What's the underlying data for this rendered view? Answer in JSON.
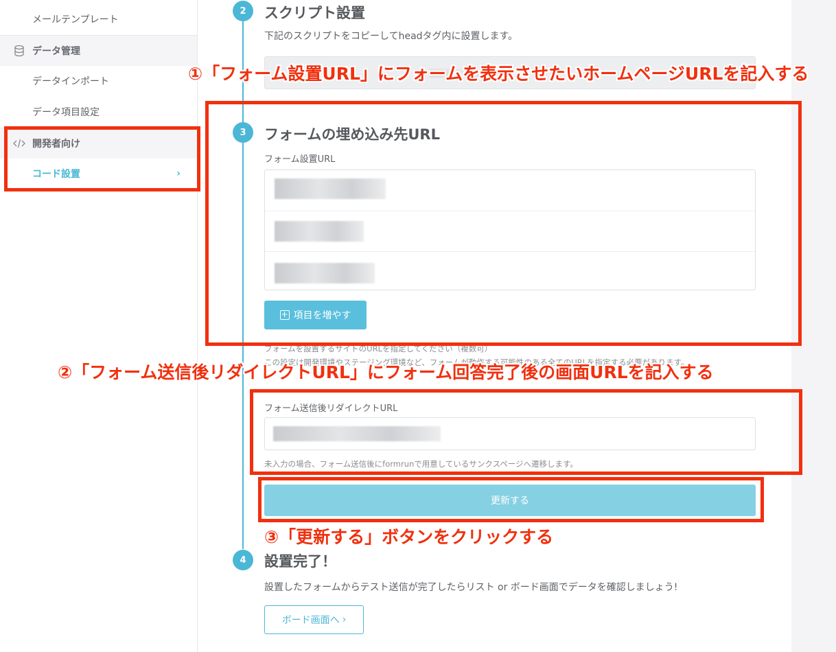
{
  "sidebar": {
    "mail_template": "メールテンプレート",
    "data_management": "データ管理",
    "data_import": "データインポート",
    "data_item_settings": "データ項目設定",
    "developers": "開発者向け",
    "code_install": "コード設置",
    "chevron": "›"
  },
  "steps": {
    "step2": {
      "num": "2",
      "title": "スクリプト設置",
      "desc": "下記のスクリプトをコピーしてheadタグ内に設置します。"
    },
    "step3": {
      "num": "3",
      "title": "フォームの埋め込み先URL",
      "field_label": "フォーム設置URL",
      "add_button": "項目を増やす",
      "help1": "フォームを設置するサイトのURLを指定してください（複数可）",
      "help2": "この設定は開発環境やステージング環境など、フォームが動作する可能性のある全てのURLを指定する必要があります。",
      "redirect_label": "フォーム送信後リダイレクトURL",
      "redirect_help": "未入力の場合、フォーム送信後にformrunで用意しているサンクスページへ遷移します。",
      "update_button": "更新する"
    },
    "step4": {
      "num": "4",
      "title": "設置完了！",
      "desc": "設置したフォームからテスト送信が完了したらリスト or ボード画面でデータを確認しましょう!",
      "board_button": "ボード画面へ"
    }
  },
  "annotations": {
    "a1": "①「フォーム設置URL」にフォームを表示させたいホームページURLを記入する",
    "a2": "②「フォーム送信後リダイレクトURL」にフォーム回答完了後の画面URLを記入する",
    "a3": "③「更新する」ボタンをクリックする"
  },
  "colors": {
    "accent": "#4bb7d6",
    "annotation": "#f1300f",
    "update_button": "#86d0e3"
  },
  "icons": {
    "database": "database-icon",
    "code": "code-icon",
    "plus": "plus-square-icon",
    "chevron": "chevron-right-icon"
  }
}
